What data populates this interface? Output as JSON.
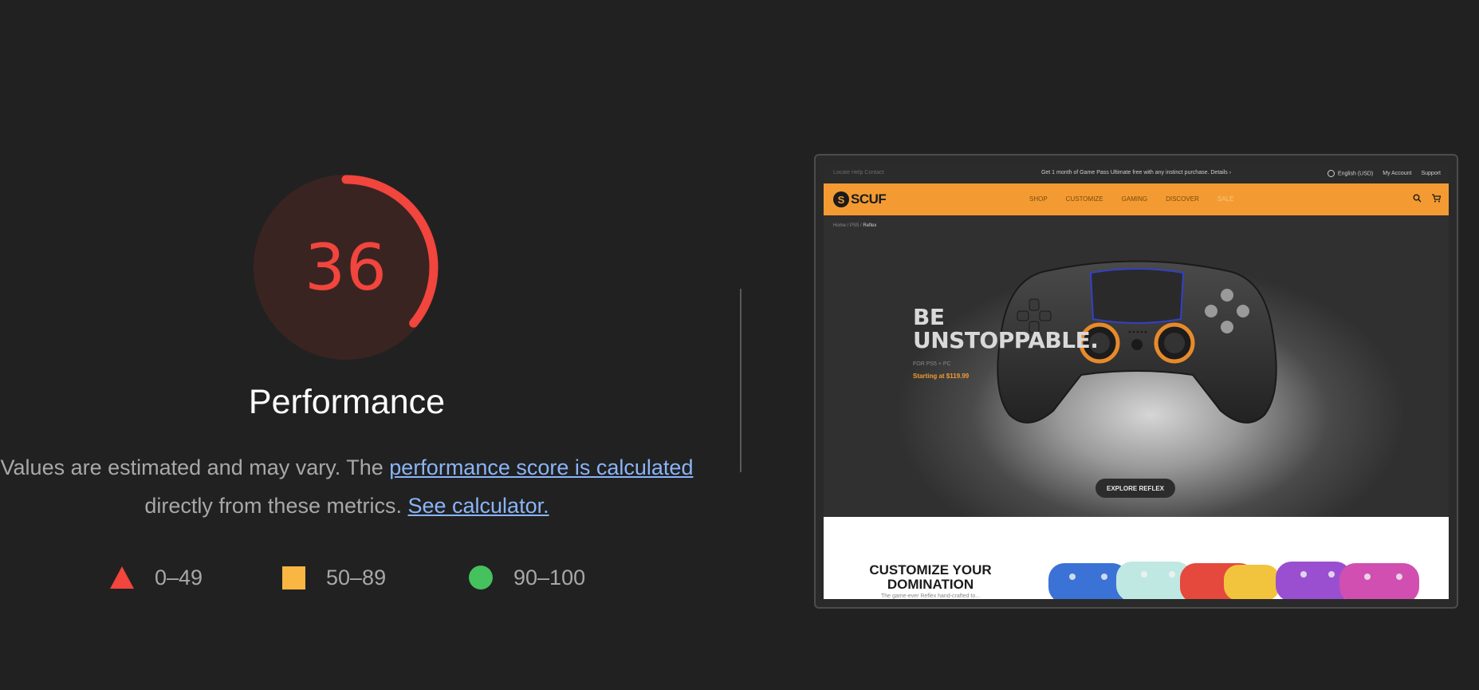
{
  "score": {
    "value": "36",
    "fraction": 0.36,
    "label": "Performance",
    "color": "#f1453d",
    "track_color": "#3a2422"
  },
  "description": {
    "pre": "Values are estimated and may vary. The ",
    "link1": "performance score is calculated",
    "mid": " directly from these metrics. ",
    "link2": "See calculator."
  },
  "legend": [
    {
      "shape": "triangle",
      "color": "#f1453d",
      "range": "0–49"
    },
    {
      "shape": "square",
      "color": "#f9b642",
      "range": "50–89"
    },
    {
      "shape": "circle",
      "color": "#45c15e",
      "range": "90–100"
    }
  ],
  "screenshot": {
    "topbar": {
      "left": "Locate   Help   Contact",
      "promo": "Get 1 month of Game Pass Ultimate free with any instinct purchase. Details ›",
      "language": "English (USD)",
      "account": "My Account",
      "support": "Support"
    },
    "brand": "SCUF",
    "nav": [
      "SHOP",
      "CUSTOMIZE",
      "GAMING",
      "DISCOVER",
      "SALE"
    ],
    "breadcrumb": {
      "home": "Home",
      "sep1": " / ",
      "section": "PS5",
      "sep2": " / ",
      "current": "Reflex"
    },
    "hero": {
      "line1": "BE",
      "line2": "UNSTOPPABLE.",
      "sub": "FOR PS5 + PC",
      "price": "Starting at $119.99",
      "cta": "EXPLORE REFLEX"
    },
    "customize": {
      "title": "CUSTOMIZE YOUR DOMINATION",
      "sub": "The game-ever Reflex hand-crafted to..."
    },
    "accent": "#f39b32"
  }
}
